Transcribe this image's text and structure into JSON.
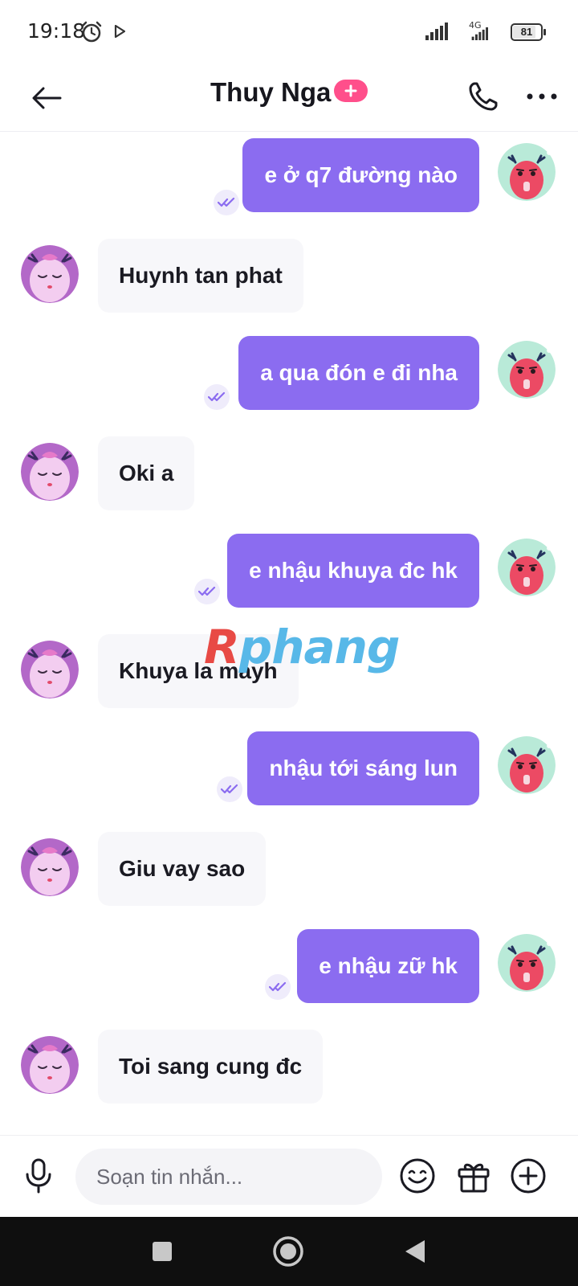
{
  "status_bar": {
    "time": "19:18",
    "network": "4G",
    "battery": "81",
    "battery_level": 0.81
  },
  "header": {
    "contact_name": "Thuy Nga"
  },
  "messages": [
    {
      "direction": "out",
      "text": "e ở q7 đường nào",
      "seen": true
    },
    {
      "direction": "in",
      "text": "Huynh tan phat"
    },
    {
      "direction": "out",
      "text": "a qua đón e đi nha",
      "seen": true
    },
    {
      "direction": "in",
      "text": "Oki a"
    },
    {
      "direction": "out",
      "text": "e nhậu khuya đc hk",
      "seen": true
    },
    {
      "direction": "in",
      "text": "Khuya la mayh"
    },
    {
      "direction": "out",
      "text": "nhậu tới sáng lun",
      "seen": true
    },
    {
      "direction": "in",
      "text": "Giu vay sao"
    },
    {
      "direction": "out",
      "text": "e nhậu zữ hk",
      "seen": true
    },
    {
      "direction": "in",
      "text": "Toi sang cung đc"
    }
  ],
  "watermark": {
    "first": "R",
    "rest": "phang"
  },
  "composer": {
    "placeholder": "Soạn tin nhắn..."
  },
  "icons": {
    "back": "arrow-left-icon",
    "add": "plus-icon",
    "call": "phone-icon",
    "more": "more-horizontal-icon",
    "mic": "microphone-icon",
    "emoji": "emoji-icon",
    "gift": "gift-icon",
    "attach": "plus-circle-icon",
    "seen": "double-check-icon"
  },
  "colors": {
    "outgoing_bubble": "#8b6cf0",
    "incoming_bubble": "#f7f7fa",
    "badge": "#ff4f8b"
  }
}
